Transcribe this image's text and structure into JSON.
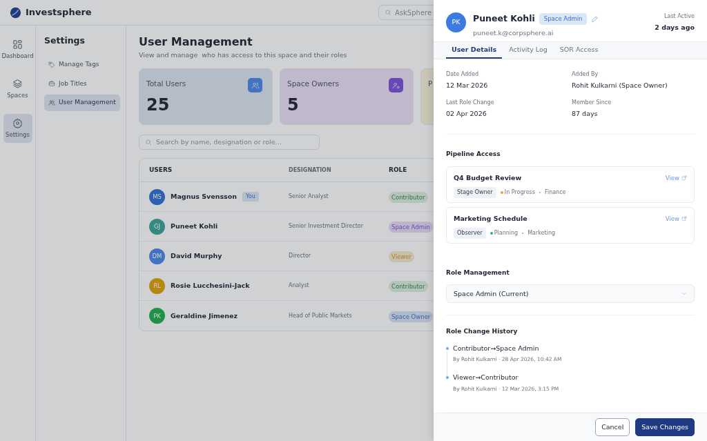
{
  "app": {
    "logo_text": "Investsphere",
    "search_placeholder": "AskSphere"
  },
  "rail": [
    {
      "label": "Dashboard",
      "selected": false
    },
    {
      "label": "Spaces",
      "selected": false
    },
    {
      "label": "Settings",
      "selected": true
    }
  ],
  "settings_nav": {
    "title": "Settings",
    "items": [
      {
        "label": "Manage Tags",
        "selected": false
      },
      {
        "label": "Job Titles",
        "selected": false
      },
      {
        "label": "User Management",
        "selected": true
      }
    ]
  },
  "page": {
    "title": "User Management",
    "subtitle": "View and manage  who has access to this space and their roles",
    "stats": [
      {
        "label": "Total Users",
        "value": "25"
      },
      {
        "label": "Space Owners",
        "value": "5"
      },
      {
        "label": "P"
      }
    ],
    "search_placeholder": "Search by name, designation or role...",
    "columns": [
      "USERS",
      "DESIGNATION",
      "ROLE"
    ],
    "rows": [
      {
        "initials": "MS",
        "name": "Magnus Svensson",
        "badge": "You",
        "designation": "Senior Analyst",
        "role": "Contributor",
        "kind": "contributor"
      },
      {
        "initials": "GJ",
        "name": "Puneet Kohli",
        "designation": "Senior Investment Director",
        "role": "Space Admin",
        "kind": "admin"
      },
      {
        "initials": "DM",
        "name": "David Murphy",
        "designation": "Director",
        "role": "Viewer",
        "kind": "viewer"
      },
      {
        "initials": "RL",
        "name": "Rosie Lucchesini-Jack",
        "designation": "Analyst",
        "role": "Contributor",
        "kind": "contributor"
      },
      {
        "initials": "PK",
        "name": "Geraldine Jimenez",
        "designation": "Head of Public Markets",
        "role": "Space Owner",
        "kind": "owner"
      }
    ]
  },
  "drawer": {
    "initials": "PK",
    "name": "Puneet Kohli",
    "role_badge": "Space Admin",
    "email": "puneet.k@corpsphere.ai",
    "last_active_label": "Last Active",
    "last_active": "2 days ago",
    "tabs": [
      {
        "label": "User Details",
        "selected": true
      },
      {
        "label": "Activity Log",
        "selected": false
      },
      {
        "label": "SOR Access",
        "selected": false
      }
    ],
    "details": [
      {
        "label": "Date Added",
        "value": "12 Mar 2026"
      },
      {
        "label": "Added By",
        "value": "Rohit Kulkarni (Space Owner)"
      },
      {
        "label": "Last Role Change",
        "value": "02 Apr 2026"
      },
      {
        "label": "Member Since",
        "value": "87 days"
      }
    ],
    "pipeline_title": "Pipeline Access",
    "pipelines": [
      {
        "title": "Q4 Budget Review",
        "link": "View",
        "tag": "Stage Owner",
        "status": "In Progress",
        "color": "#e9a23b",
        "category": "Finance"
      },
      {
        "title": "Marketing Schedule",
        "link": "View",
        "tag": "Observer",
        "status": "Planning",
        "color": "#2bb673",
        "category": "Marketing"
      }
    ],
    "role_title": "Role Management",
    "role_value": "Space Admin (Current)",
    "history_title": "Role Change History",
    "history": [
      {
        "change": "Contributor→Space Admin",
        "meta": "By Rohit Kulkarni · 28 Apr 2026, 10:42 AM"
      },
      {
        "change": "Viewer→Contributor",
        "meta": "By Rohit Kulkarni · 12 Mar 2026, 3:15 PM"
      }
    ],
    "buttons": [
      {
        "label": "Cancel",
        "kind": "secondary"
      },
      {
        "label": "Save Changes",
        "kind": "primary"
      }
    ]
  }
}
